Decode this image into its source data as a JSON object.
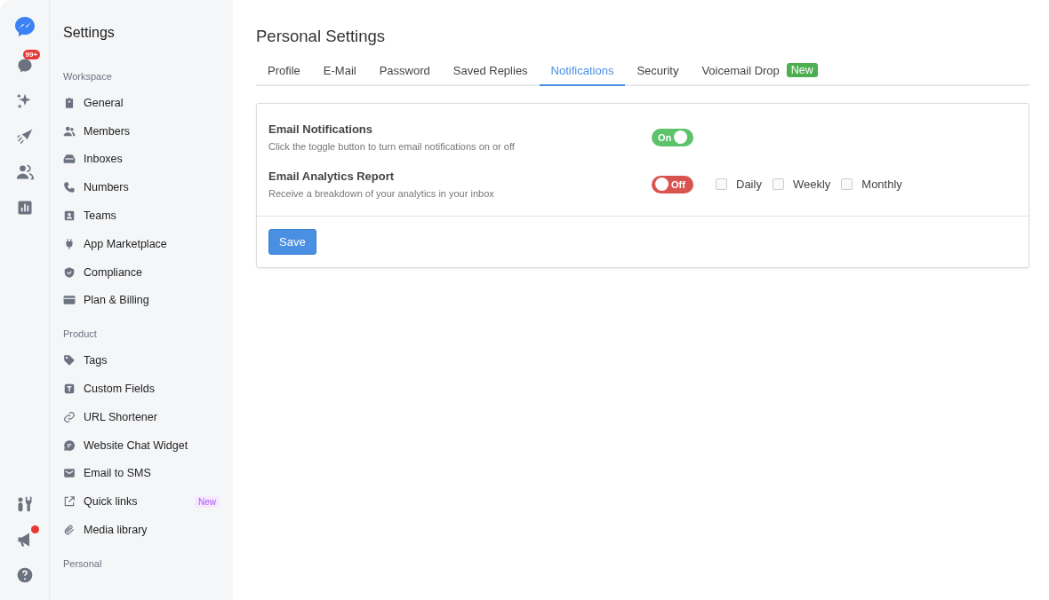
{
  "rail": {
    "chat_badge": "99+",
    "announcements_dot": true
  },
  "sidebar": {
    "title": "Settings",
    "sections": [
      {
        "heading": "Workspace",
        "items": [
          {
            "label": "General"
          },
          {
            "label": "Members"
          },
          {
            "label": "Inboxes"
          },
          {
            "label": "Numbers"
          },
          {
            "label": "Teams"
          },
          {
            "label": "App Marketplace"
          },
          {
            "label": "Compliance"
          },
          {
            "label": "Plan & Billing"
          }
        ]
      },
      {
        "heading": "Product",
        "items": [
          {
            "label": "Tags"
          },
          {
            "label": "Custom Fields"
          },
          {
            "label": "URL Shortener"
          },
          {
            "label": "Website Chat Widget"
          },
          {
            "label": "Email to SMS"
          },
          {
            "label": "Quick links",
            "badge": "New"
          },
          {
            "label": "Media library"
          }
        ]
      },
      {
        "heading": "Personal"
      }
    ]
  },
  "page": {
    "title": "Personal Settings",
    "tabs": [
      {
        "label": "Profile",
        "selected": false
      },
      {
        "label": "E-Mail",
        "selected": false
      },
      {
        "label": "Password",
        "selected": false
      },
      {
        "label": "Saved Replies",
        "selected": false
      },
      {
        "label": "Notifications",
        "selected": true
      },
      {
        "label": "Security",
        "selected": false
      },
      {
        "label": "Voicemail Drop",
        "selected": false,
        "badge": "New"
      }
    ],
    "settings": [
      {
        "title": "Email Notifications",
        "description": "Click the toggle button to turn email notifications on or off",
        "on": true,
        "toggle_label": "On"
      },
      {
        "title": "Email Analytics Report",
        "description": "Receive a breakdown of your analytics in your inbox",
        "on": false,
        "toggle_label": "Off",
        "options": [
          {
            "label": "Daily",
            "checked": false
          },
          {
            "label": "Weekly",
            "checked": false
          },
          {
            "label": "Monthly",
            "checked": false
          }
        ]
      }
    ],
    "save_button": "Save"
  }
}
